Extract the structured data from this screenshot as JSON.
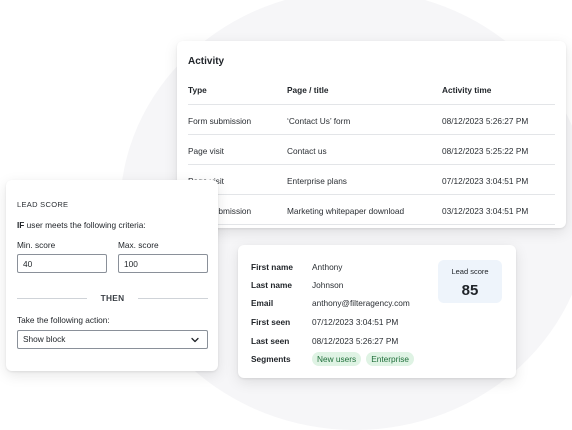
{
  "activity": {
    "title": "Activity",
    "columns": [
      "Type",
      "Page / title",
      "Activity time"
    ],
    "rows": [
      {
        "type": "Form submission",
        "page": "‘Contact Us’ form",
        "time": "08/12/2023  5:26:27 PM"
      },
      {
        "type": "Page visit",
        "page": "Contact us",
        "time": "08/12/2023  5:25:22 PM"
      },
      {
        "type": "Page visit",
        "page": "Enterprise plans",
        "time": "07/12/2023  3:04:51 PM"
      },
      {
        "type": "Form submission",
        "page": "Marketing whitepaper download",
        "time": "03/12/2023  3:04:51 PM"
      }
    ]
  },
  "lead_rule": {
    "header": "LEAD SCORE",
    "criteria_if": "IF",
    "criteria_text": " user meets the following criteria:",
    "min_label": "Min. score",
    "min_value": "40",
    "max_label": "Max. score",
    "max_value": "100",
    "then_label": "THEN",
    "action_label": "Take the following action:",
    "action_value": "Show block"
  },
  "contact": {
    "fields": [
      {
        "label": "First name",
        "value": "Anthony"
      },
      {
        "label": "Last name",
        "value": "Johnson"
      },
      {
        "label": "Email",
        "value": "anthony@filteragency.com"
      },
      {
        "label": "First seen",
        "value": "07/12/2023  3:04:51 PM"
      },
      {
        "label": "Last seen",
        "value": "08/12/2023  5:26:27 PM"
      }
    ],
    "segments_label": "Segments",
    "segments": [
      "New users",
      "Enterprise"
    ],
    "lead_score_label": "Lead score",
    "lead_score_value": "85"
  },
  "colors": {
    "segment_badge_bg": "#dff3e4",
    "segment_badge_text": "#1f6f3a",
    "score_box_bg": "#eef4fb"
  },
  "icons": {
    "select_chevron": "chevron-down-icon"
  }
}
